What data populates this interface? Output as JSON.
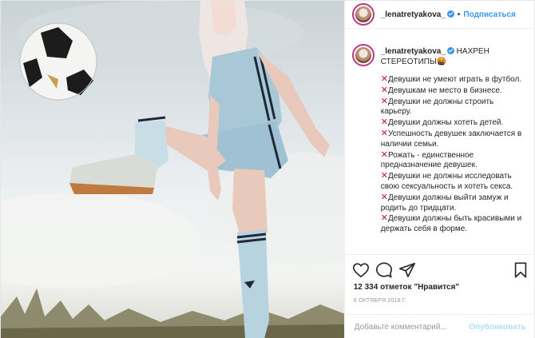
{
  "post": {
    "username": "_lenatretyakova_",
    "follow_label": "Подписаться",
    "dot": "•",
    "caption_title": "НАХРЕН СТЕРЕОТИПЫ🤬",
    "caption_lines": [
      "Девушки не умеют играть в футбол.",
      "Девушкам не место в бизнесе.",
      "Девушки не должны строить карьеру.",
      "Девушки должны хотеть детей.",
      "Успешность девушек заключается в наличии семьи.",
      "Рожать - единственное предназначение девушек.",
      "Девушки не должны исследовать свою сексуальность и хотеть секса.",
      "Девушки должны выйти замуж и родить до тридцати.",
      "Девушки должны быть красивыми и держать себя в форме."
    ],
    "cross_glyph": "✕",
    "likes": "12 334 отметок \"Нравится\"",
    "date": "8 ОКТЯБРЯ 2018 Г.",
    "comment_placeholder": "Добавьте комментарий...",
    "publish_label": "Опубликовать"
  },
  "icons": {
    "like": "heart-icon",
    "comment": "comment-icon",
    "share": "share-icon",
    "save": "bookmark-icon"
  },
  "colors": {
    "link": "#3897f0",
    "publish_disabled": "#b2dffc",
    "cross": "#d0102a",
    "story_ring": "#c13584"
  }
}
